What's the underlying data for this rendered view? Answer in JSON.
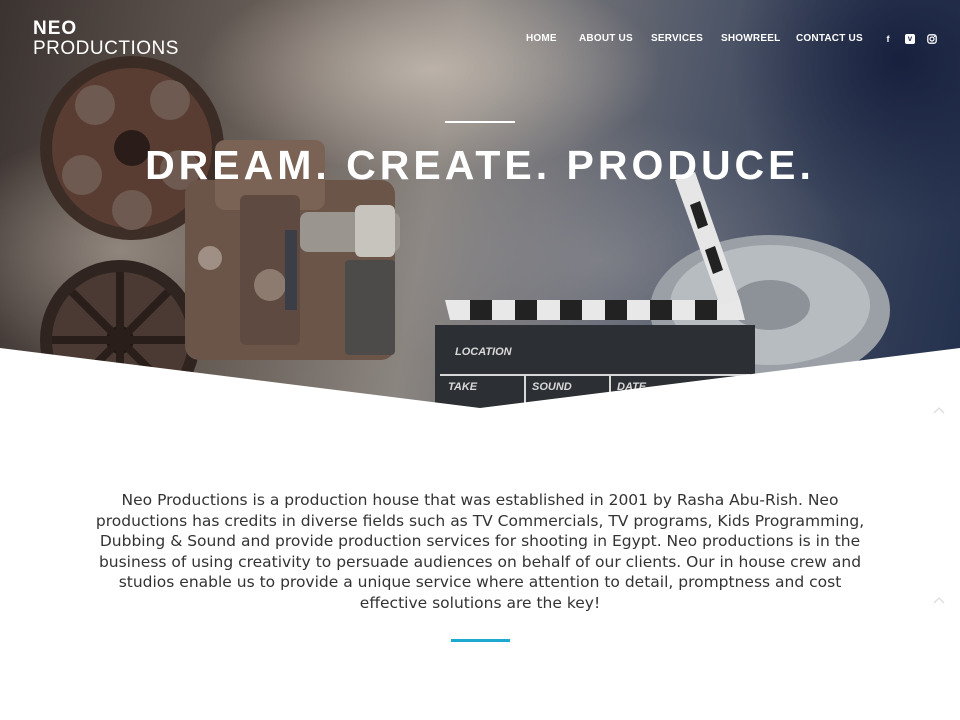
{
  "brand": {
    "name_top": "NEO",
    "name_bottom": "PRODUCTIONS"
  },
  "nav": {
    "items": [
      "HOME",
      "ABOUT US",
      "SERVICES",
      "SHOWREEL",
      "CONTACT US"
    ]
  },
  "social": [
    {
      "icon": "facebook-icon",
      "glyph": "f"
    },
    {
      "icon": "vimeo-icon",
      "glyph": "v"
    },
    {
      "icon": "instagram-icon",
      "glyph": ""
    }
  ],
  "hero": {
    "headline": "DREAM. CREATE. PRODUCE.",
    "clapper": {
      "location": "LOCATION",
      "take": "TAKE",
      "sound": "SOUND",
      "date": "DATE"
    }
  },
  "about": {
    "text": "Neo Productions is a production house that was established in 2001 by Rasha Abu-Rish. Neo productions has credits in diverse fields such as TV Commercials, TV programs, Kids Programming, Dubbing & Sound and provide production services for shooting in Egypt. Neo productions is in the business of using creativity to persuade audiences on behalf of our clients. Our in house crew and studios enable us to provide a unique service where attention to detail, promptness and cost effective solutions are the key!"
  },
  "colors": {
    "accent": "#1ba9cf",
    "hero_text": "#ffffff",
    "body_text": "#333333"
  }
}
